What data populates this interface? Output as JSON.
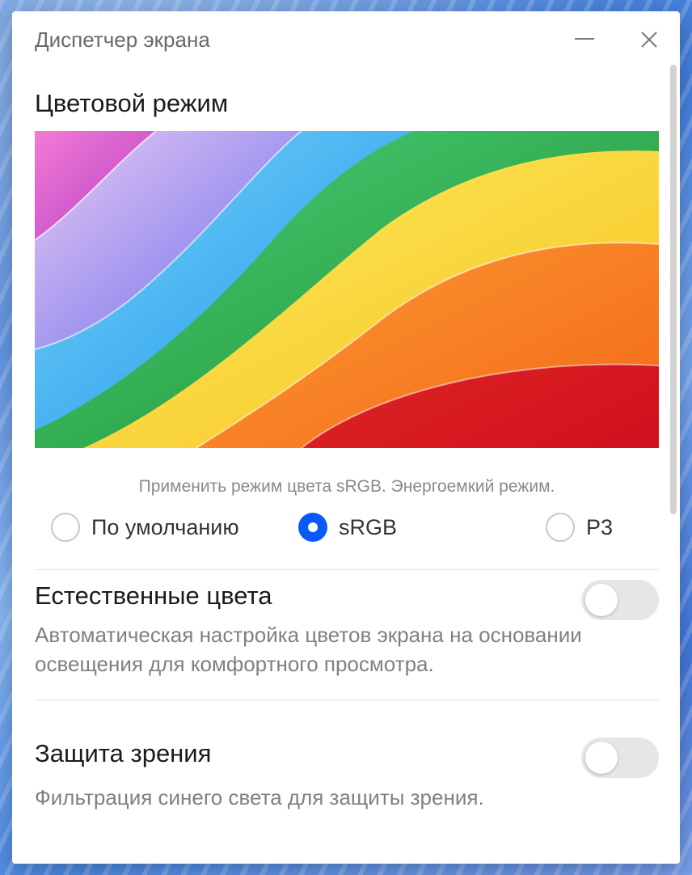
{
  "window": {
    "title": "Диспетчер экрана",
    "minimize_icon": "minimize-icon",
    "close_icon": "close-icon"
  },
  "color_mode": {
    "heading": "Цветовой режим",
    "caption": "Применить режим цвета sRGB. Энергоемкий режим.",
    "options": [
      {
        "label": "По умолчанию",
        "selected": false
      },
      {
        "label": "sRGB",
        "selected": true
      },
      {
        "label": "P3",
        "selected": false
      }
    ],
    "accent_color": "#0a59f7"
  },
  "natural_colors": {
    "title": "Естественные цвета",
    "description": "Автоматическая настройка цветов экрана на основании освещения для комфортного просмотра.",
    "enabled": false
  },
  "eye_comfort": {
    "title": "Защита зрения",
    "description": "Фильтрация синего света для защиты зрения.",
    "enabled": false
  }
}
